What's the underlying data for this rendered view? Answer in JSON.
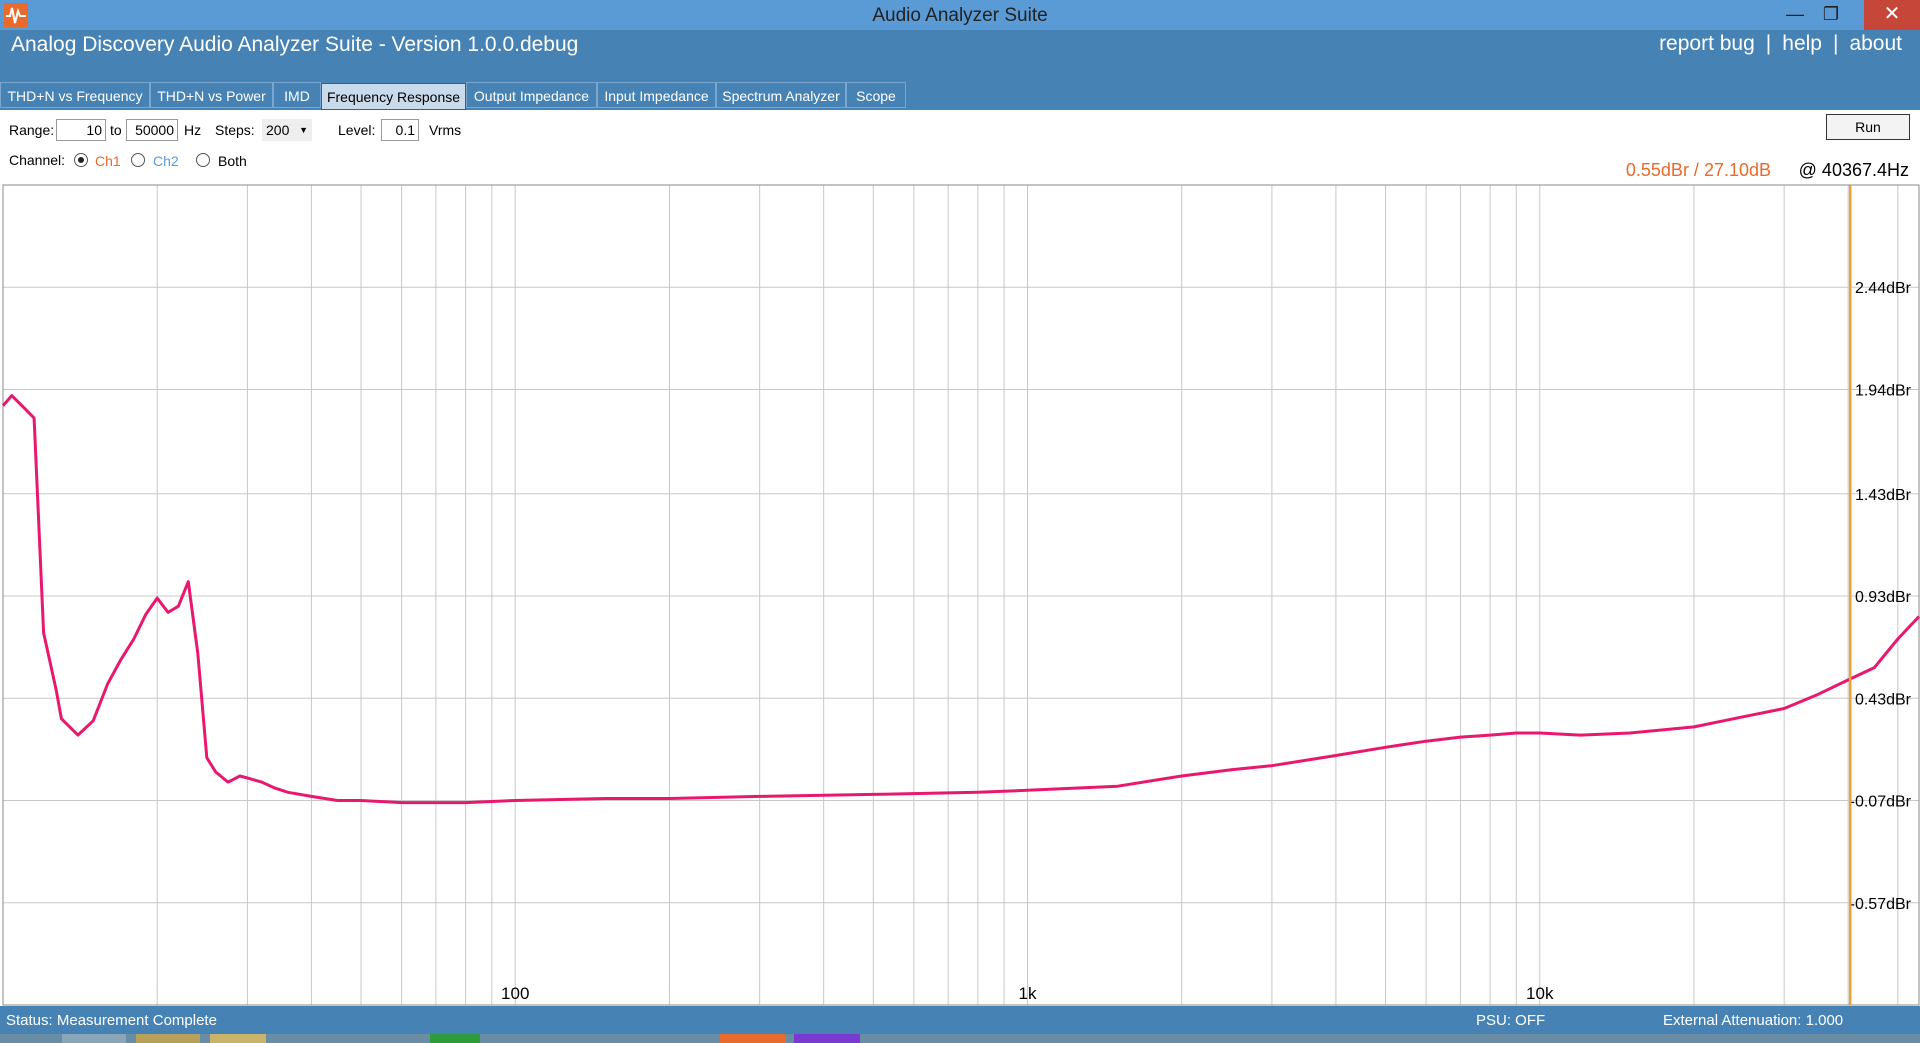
{
  "window": {
    "title": "Audio Analyzer Suite"
  },
  "header": {
    "app_title": "Analog Discovery Audio Analyzer Suite - Version   1.0.0.debug",
    "links": [
      "report bug",
      "help",
      "about"
    ],
    "separator": "|"
  },
  "tabs": [
    {
      "label": "THD+N vs Frequency"
    },
    {
      "label": "THD+N vs Power"
    },
    {
      "label": "IMD"
    },
    {
      "label": "Frequency Response",
      "active": true
    },
    {
      "label": "Output Impedance"
    },
    {
      "label": "Input Impedance"
    },
    {
      "label": "Spectrum Analyzer"
    },
    {
      "label": "Scope"
    }
  ],
  "controls": {
    "range_label": "Range:",
    "range_from": "10",
    "range_to_label": "to",
    "range_to": "50000",
    "range_unit": "Hz",
    "steps_label": "Steps:",
    "steps_value": "200",
    "level_label": "Level:",
    "level_value": "0.1",
    "level_unit": "Vrms",
    "channel_label": "Channel:",
    "channels": [
      {
        "label": "Ch1",
        "checked": true,
        "color": "#e86a2c"
      },
      {
        "label": "Ch2",
        "checked": false,
        "color": "#5b9bd5"
      },
      {
        "label": "Both",
        "checked": false,
        "color": "#000000"
      }
    ],
    "run_label": "Run"
  },
  "readout": {
    "value": "0.55dBr / 27.10dB",
    "frequency": "@ 40367.4Hz",
    "value_color": "#e86a2c"
  },
  "chart_data": {
    "type": "line",
    "x_scale": "log",
    "xlim": [
      10,
      55000
    ],
    "ylim": [
      -1.07,
      2.94
    ],
    "y_ticks": [
      2.44,
      1.94,
      1.43,
      0.93,
      0.43,
      -0.07,
      -0.57
    ],
    "y_tick_labels": [
      "2.44dBr",
      "1.94dBr",
      "1.43dBr",
      "0.93dBr",
      "0.43dBr",
      "-0.07dBr",
      "-0.57dBr"
    ],
    "x_tick_labels": [
      {
        "value": 100,
        "label": "100"
      },
      {
        "value": 1000,
        "label": "1k"
      },
      {
        "value": 10000,
        "label": "10k"
      }
    ],
    "grid": true,
    "cursor_x": 40367.4,
    "cursor_color": "#f0a030",
    "series": [
      {
        "color": "#e8186e",
        "x": [
          10,
          10.4,
          11,
          11.5,
          12,
          12.7,
          13,
          14,
          15,
          16,
          17,
          18,
          19,
          20,
          21,
          22,
          23,
          24,
          25,
          26,
          27.5,
          28,
          29,
          30,
          32,
          34,
          36,
          40,
          45,
          50,
          60,
          70,
          80,
          100,
          150,
          200,
          300,
          500,
          800,
          1000,
          1500,
          2000,
          2500,
          3000,
          4000,
          5000,
          6000,
          7000,
          8000,
          9000,
          10000,
          12000,
          15000,
          20000,
          25000,
          30000,
          35000,
          40000,
          45000,
          50000,
          55000
        ],
        "y": [
          1.86,
          1.91,
          1.85,
          1.8,
          0.75,
          0.47,
          0.33,
          0.25,
          0.32,
          0.5,
          0.62,
          0.72,
          0.84,
          0.92,
          0.85,
          0.88,
          1.0,
          0.65,
          0.14,
          0.07,
          0.02,
          0.03,
          0.05,
          0.04,
          0.02,
          -0.01,
          -0.03,
          -0.05,
          -0.07,
          -0.07,
          -0.08,
          -0.08,
          -0.08,
          -0.07,
          -0.06,
          -0.06,
          -0.05,
          -0.04,
          -0.03,
          -0.02,
          0.0,
          0.05,
          0.08,
          0.1,
          0.15,
          0.19,
          0.22,
          0.24,
          0.25,
          0.26,
          0.26,
          0.25,
          0.26,
          0.29,
          0.34,
          0.38,
          0.45,
          0.52,
          0.58,
          0.72,
          0.83
        ]
      }
    ]
  },
  "status": {
    "text": "Status: Measurement Complete",
    "psu": "PSU: OFF",
    "attenuation": "External Attenuation: 1.000"
  },
  "colors": {
    "header_bg": "#4682b4",
    "titlebar_bg": "#5b9bd5",
    "close_bg": "#c7463a"
  }
}
